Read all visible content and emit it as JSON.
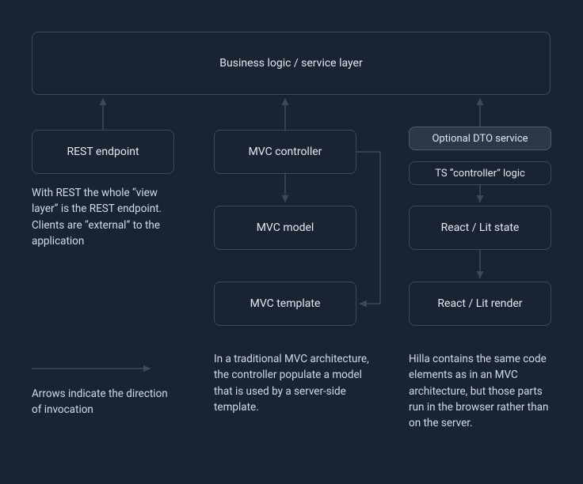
{
  "boxes": {
    "service_layer": "Business logic / service layer",
    "rest_endpoint": "REST endpoint",
    "mvc_controller": "MVC controller",
    "mvc_model": "MVC model",
    "mvc_template": "MVC template",
    "dto_service": "Optional DTO service",
    "ts_controller": "TS “controller” logic",
    "react_state": "React / Lit state",
    "react_render": "React / Lit render"
  },
  "descriptions": {
    "rest": "With REST the whole “view layer” is the REST endpoint. Clients are “external” to the application",
    "mvc": "In a traditional MVC architecture, the controller populate a model that is used by a server-side template.",
    "hilla": "Hilla contains the same code elements as in an MVC architecture, but those parts run in the browser rather than on the server.",
    "legend": "Arrows indicate the direction of invocation"
  }
}
